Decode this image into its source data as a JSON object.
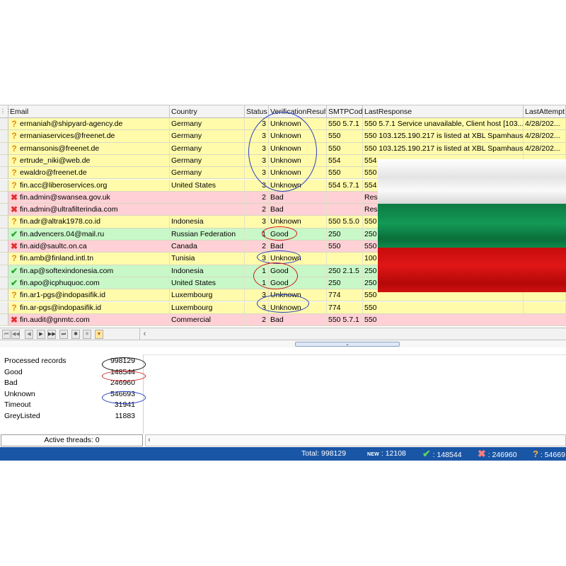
{
  "columns": {
    "email": "Email",
    "country": "Country",
    "status": "Status",
    "result": "VerificationResult",
    "smtp": "SMTPCode",
    "last": "LastResponse",
    "attempt": "LastAttempt"
  },
  "rows": [
    {
      "icon": "question-icon",
      "color": "yellow",
      "email": "ermaniah@shipyard-agency.de",
      "country": "Germany",
      "status": "3",
      "result": "Unknown",
      "smtp": "550 5.7.1",
      "last": "550 5.7.1 Service unavailable, Client host [103....",
      "attempt": "4/28/202..."
    },
    {
      "icon": "question-icon",
      "color": "yellow",
      "email": "ermaniaservices@freenet.de",
      "country": "Germany",
      "status": "3",
      "result": "Unknown",
      "smtp": "550",
      "last": "550 103.125.190.217 is listed at XBL Spamhaus",
      "attempt": "4/28/202..."
    },
    {
      "icon": "question-icon",
      "color": "yellow",
      "email": "ermansonis@freenet.de",
      "country": "Germany",
      "status": "3",
      "result": "Unknown",
      "smtp": "550",
      "last": "550 103.125.190.217 is listed at XBL Spamhaus",
      "attempt": "4/28/202..."
    },
    {
      "icon": "question-icon",
      "color": "yellow",
      "email": "ertrude_niki@web.de",
      "country": "Germany",
      "status": "3",
      "result": "Unknown",
      "smtp": "554",
      "last": "554",
      "attempt": ""
    },
    {
      "icon": "question-icon",
      "color": "yellow",
      "email": "ewaldro@freenet.de",
      "country": "Germany",
      "status": "3",
      "result": "Unknown",
      "smtp": "550",
      "last": "550",
      "attempt": ""
    },
    {
      "icon": "question-icon",
      "color": "yellow",
      "email": "fin.acc@liberoservices.org",
      "country": "United States",
      "status": "3",
      "result": "Unknown",
      "smtp": "554 5.7.1",
      "last": "554",
      "attempt": ""
    },
    {
      "icon": "cross-icon",
      "color": "red",
      "email": "fin.admin@swansea.gov.uk",
      "country": "",
      "status": "2",
      "result": "Bad",
      "smtp": "",
      "last": "Res",
      "attempt": ""
    },
    {
      "icon": "cross-icon",
      "color": "red",
      "email": "fin.admin@ultrafilterindia.com",
      "country": "",
      "status": "2",
      "result": "Bad",
      "smtp": "",
      "last": "Res",
      "attempt": ""
    },
    {
      "icon": "question-icon",
      "color": "yellow",
      "email": "fin.adr@altrak1978.co.id",
      "country": "Indonesia",
      "status": "3",
      "result": "Unknown",
      "smtp": "550 5.5.0",
      "last": "550",
      "attempt": ""
    },
    {
      "icon": "check-icon",
      "color": "green",
      "email": "fin.advencers.04@mail.ru",
      "country": "Russian Federation",
      "status": "1",
      "result": "Good",
      "smtp": "250",
      "last": "250",
      "attempt": ""
    },
    {
      "icon": "cross-icon",
      "color": "red",
      "email": "fin.aid@saultc.on.ca",
      "country": "Canada",
      "status": "2",
      "result": "Bad",
      "smtp": "550",
      "last": "550",
      "attempt": ""
    },
    {
      "icon": "question-icon",
      "color": "yellow",
      "email": "fin.amb@finland.intl.tn",
      "country": "Tunisia",
      "status": "3",
      "result": "Unknown",
      "smtp": "",
      "last": "100",
      "attempt": ""
    },
    {
      "icon": "check-icon",
      "color": "green",
      "email": "fin.ap@softexindonesia.com",
      "country": "Indonesia",
      "status": "1",
      "result": "Good",
      "smtp": "250 2.1.5",
      "last": "250",
      "attempt": ""
    },
    {
      "icon": "check-icon",
      "color": "green",
      "email": "fin.apo@icphuquoc.com",
      "country": "United States",
      "status": "1",
      "result": "Good",
      "smtp": "250",
      "last": "250",
      "attempt": ""
    },
    {
      "icon": "question-icon",
      "color": "yellow",
      "email": "fin.ar1-pgs@indopasifik.id",
      "country": "Luxembourg",
      "status": "3",
      "result": "Unknown",
      "smtp": "774",
      "last": "550",
      "attempt": ""
    },
    {
      "icon": "question-icon",
      "color": "yellow",
      "email": "fin.ar-pgs@indopasifik.id",
      "country": "Luxembourg",
      "status": "3",
      "result": "Unknown",
      "smtp": "774",
      "last": "550",
      "attempt": ""
    },
    {
      "icon": "cross-icon",
      "color": "red",
      "email": "fin.audit@gnmtc.com",
      "country": "Commercial",
      "status": "2",
      "result": "Bad",
      "smtp": "550 5.7.1",
      "last": "550",
      "attempt": ""
    }
  ],
  "stats": [
    {
      "label": "Processed records",
      "value": "998129"
    },
    {
      "label": "Good",
      "value": "148544"
    },
    {
      "label": "Bad",
      "value": "246960"
    },
    {
      "label": "Unknown",
      "value": "546693"
    },
    {
      "label": "Timeout",
      "value": "31941"
    },
    {
      "label": "GreyListed",
      "value": "11883"
    }
  ],
  "threads": "Active threads: 0",
  "statusbar": {
    "total": "Total: 998129",
    "new_badge": "NEW",
    "new": ": 12108",
    "good": ": 148544",
    "bad": ": 246960",
    "unknown": ": 54669"
  },
  "colors": {
    "row_yellow": "#fffbab",
    "row_red": "#ffd0d6",
    "row_green": "#c8f8c8",
    "statusbar": "#1a56a6",
    "flag_white": "#f2f2f2",
    "flag_green": "#0a8a4a",
    "flag_red": "#d01010",
    "ellipse_blue": "#2a3fbf",
    "ellipse_red": "#d01818",
    "ellipse_black": "#111111"
  }
}
